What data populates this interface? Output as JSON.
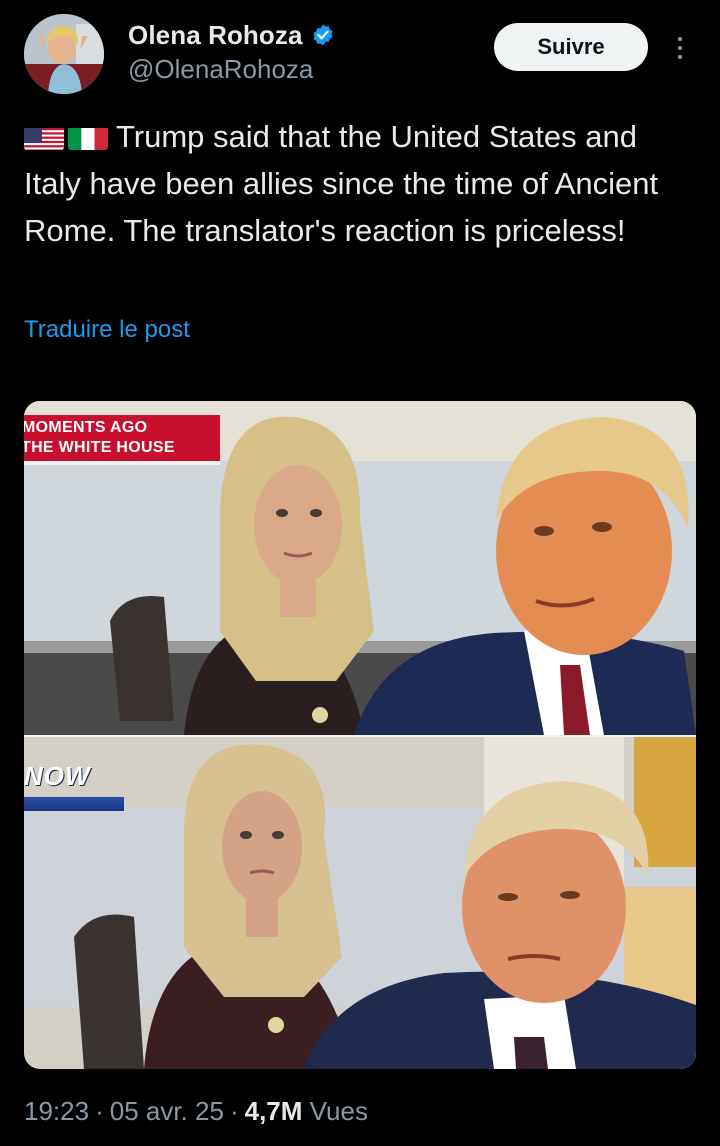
{
  "author": {
    "display_name": "Olena Rohoza",
    "handle": "@OlenaRohoza",
    "verified": true,
    "avatar_icon": "profile-photo"
  },
  "actions": {
    "follow_label": "Suivre",
    "more_icon": "more-vertical-icon"
  },
  "post": {
    "flags": [
      "us-flag-icon",
      "italy-flag-icon"
    ],
    "text": "Trump said that the United States and Italy have been allies since the time of Ancient Rome. The translator's reaction is priceless!",
    "translate_label": "Traduire le post"
  },
  "media": {
    "top_chyron_line1": "MOMENTS AGO",
    "top_chyron_line2": "THE WHITE HOUSE",
    "bottom_logo_text": "NOW"
  },
  "footer": {
    "time": "19:23",
    "date": "05 avr. 25",
    "views_count": "4,7M",
    "views_label": "Vues",
    "separator": "·"
  },
  "colors": {
    "background": "#000000",
    "text_primary": "#e7e9ea",
    "text_secondary": "#8b98a5",
    "link": "#1d9bf0",
    "verified": "#1d9bf0",
    "chyron_red": "#c8102e"
  }
}
